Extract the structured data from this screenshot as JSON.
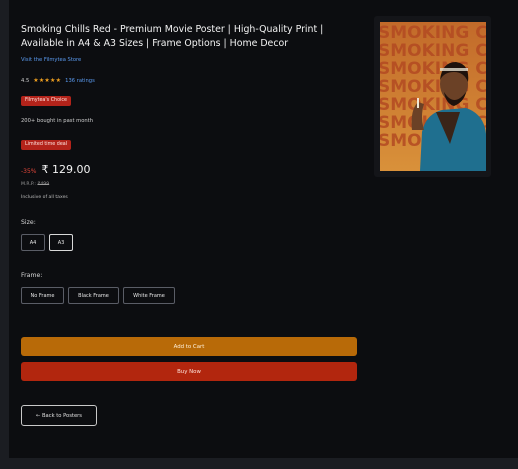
{
  "product": {
    "title": "Smoking Chills Red - Premium Movie Poster | High-Quality Print | Available in A4 & A3 Sizes | Frame Options | Home Decor",
    "store_link": "Visit the Filmytea Store",
    "rating": "4.5",
    "stars": "★★★★★",
    "ratings_count": "136 ratings",
    "choice_badge": "Filmytea's Choice",
    "bought": "200+ bought in past month",
    "deal_badge": "Limited time deal",
    "discount": "-35%",
    "price": "₹ 129.00",
    "mrp_label": "M.R.P.:",
    "mrp_value": "₹499",
    "tax_note": "Inclusive of all taxes",
    "poster_text": "SMOKING CHILLS"
  },
  "size": {
    "label": "Size:",
    "options": [
      "A4",
      "A3"
    ],
    "selected": "A3"
  },
  "frame": {
    "label": "Frame:",
    "options": [
      "No Frame",
      "Black Frame",
      "White Frame"
    ],
    "selected": "No Frame"
  },
  "actions": {
    "add_to_cart": "Add to Cart",
    "buy_now": "Buy Now",
    "back": "← Back to Posters"
  },
  "colors": {
    "page_bg": "#0c0d10",
    "add_to_cart": "#b86a08",
    "buy_now": "#b2260e",
    "badge": "#b3231a",
    "link": "#5b9bf0",
    "discount": "#e0463a"
  }
}
